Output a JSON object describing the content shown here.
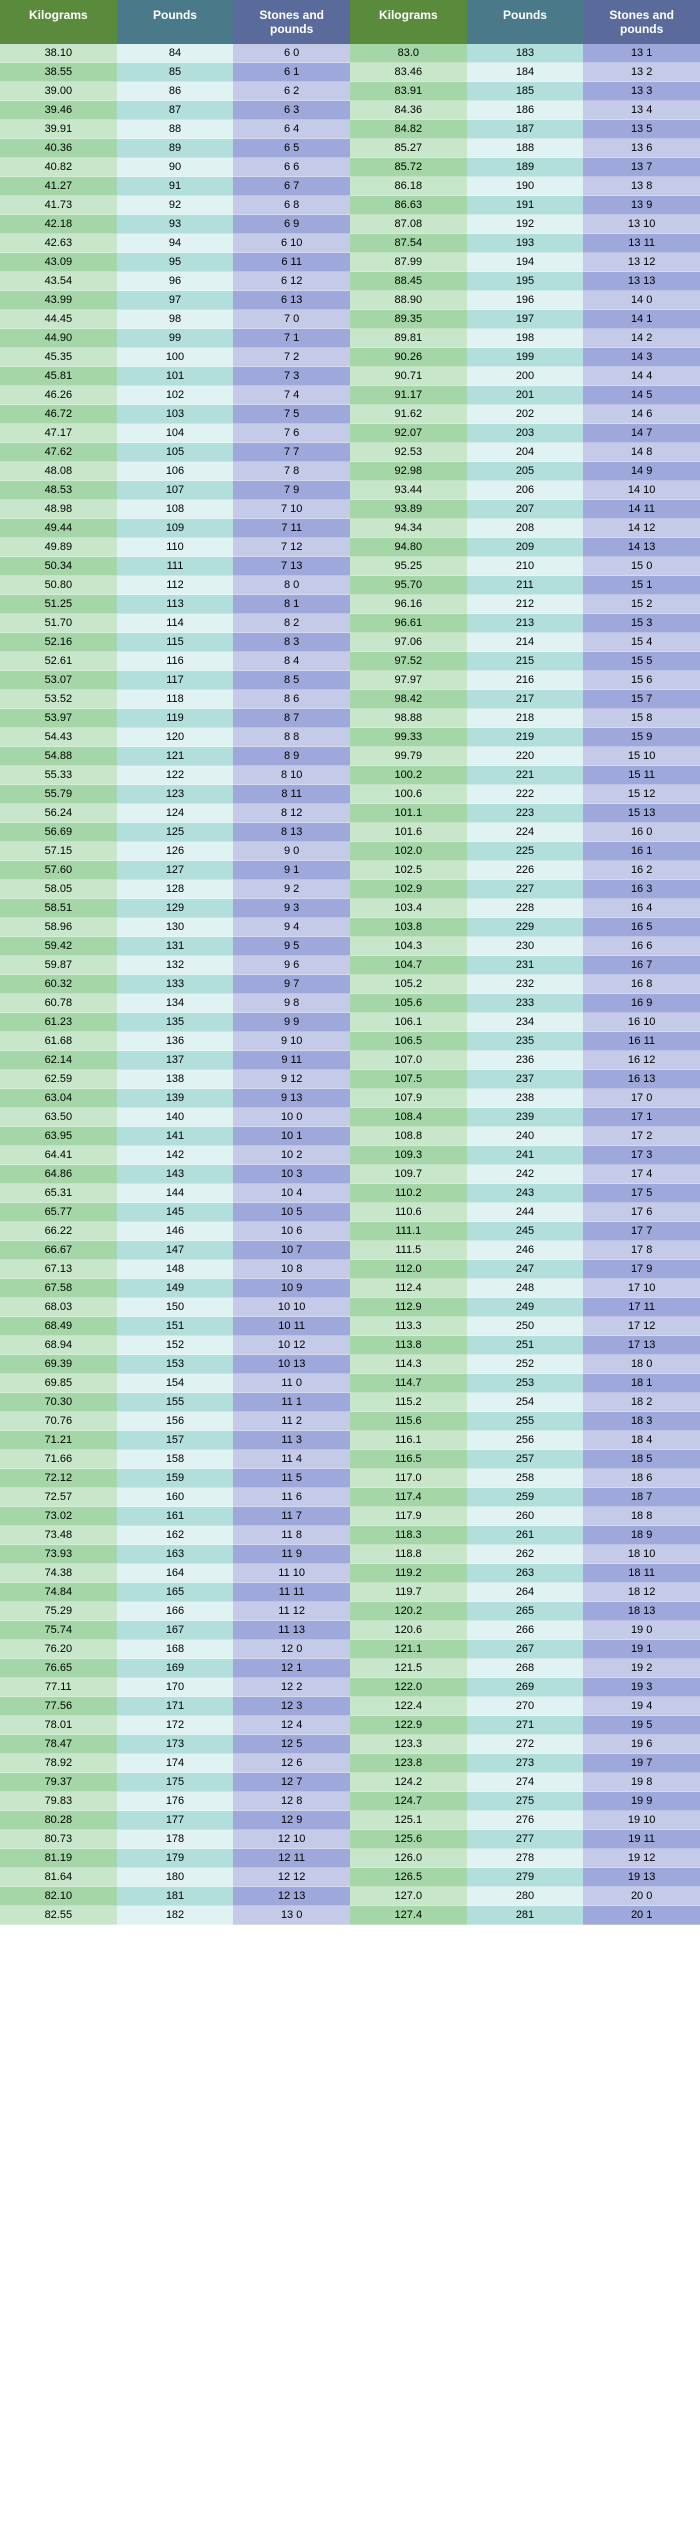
{
  "headers": {
    "kilograms": "Kilograms",
    "pounds": "Pounds",
    "stones_and_pounds": "Stones and pounds"
  },
  "rows": [
    {
      "kg": "38.10",
      "lb": 84,
      "st": 6,
      "sp": 0
    },
    {
      "kg": "38.55",
      "lb": 85,
      "st": 6,
      "sp": 1
    },
    {
      "kg": "39.00",
      "lb": 86,
      "st": 6,
      "sp": 2
    },
    {
      "kg": "39.46",
      "lb": 87,
      "st": 6,
      "sp": 3
    },
    {
      "kg": "39.91",
      "lb": 88,
      "st": 6,
      "sp": 4
    },
    {
      "kg": "40.36",
      "lb": 89,
      "st": 6,
      "sp": 5
    },
    {
      "kg": "40.82",
      "lb": 90,
      "st": 6,
      "sp": 6
    },
    {
      "kg": "41.27",
      "lb": 91,
      "st": 6,
      "sp": 7
    },
    {
      "kg": "41.73",
      "lb": 92,
      "st": 6,
      "sp": 8
    },
    {
      "kg": "42.18",
      "lb": 93,
      "st": 6,
      "sp": 9
    },
    {
      "kg": "42.63",
      "lb": 94,
      "st": 6,
      "sp": 10
    },
    {
      "kg": "43.09",
      "lb": 95,
      "st": 6,
      "sp": 11
    },
    {
      "kg": "43.54",
      "lb": 96,
      "st": 6,
      "sp": 12
    },
    {
      "kg": "43.99",
      "lb": 97,
      "st": 6,
      "sp": 13
    },
    {
      "kg": "44.45",
      "lb": 98,
      "st": 7,
      "sp": 0
    },
    {
      "kg": "44.90",
      "lb": 99,
      "st": 7,
      "sp": 1
    },
    {
      "kg": "45.35",
      "lb": 100,
      "st": 7,
      "sp": 2
    },
    {
      "kg": "45.81",
      "lb": 101,
      "st": 7,
      "sp": 3
    },
    {
      "kg": "46.26",
      "lb": 102,
      "st": 7,
      "sp": 4
    },
    {
      "kg": "46.72",
      "lb": 103,
      "st": 7,
      "sp": 5
    },
    {
      "kg": "47.17",
      "lb": 104,
      "st": 7,
      "sp": 6
    },
    {
      "kg": "47.62",
      "lb": 105,
      "st": 7,
      "sp": 7
    },
    {
      "kg": "48.08",
      "lb": 106,
      "st": 7,
      "sp": 8
    },
    {
      "kg": "48.53",
      "lb": 107,
      "st": 7,
      "sp": 9
    },
    {
      "kg": "48.98",
      "lb": 108,
      "st": 7,
      "sp": 10
    },
    {
      "kg": "49.44",
      "lb": 109,
      "st": 7,
      "sp": 11
    },
    {
      "kg": "49.89",
      "lb": 110,
      "st": 7,
      "sp": 12
    },
    {
      "kg": "50.34",
      "lb": 111,
      "st": 7,
      "sp": 13
    },
    {
      "kg": "50.80",
      "lb": 112,
      "st": 8,
      "sp": 0
    },
    {
      "kg": "51.25",
      "lb": 113,
      "st": 8,
      "sp": 1
    },
    {
      "kg": "51.70",
      "lb": 114,
      "st": 8,
      "sp": 2
    },
    {
      "kg": "52.16",
      "lb": 115,
      "st": 8,
      "sp": 3
    },
    {
      "kg": "52.61",
      "lb": 116,
      "st": 8,
      "sp": 4
    },
    {
      "kg": "53.07",
      "lb": 117,
      "st": 8,
      "sp": 5
    },
    {
      "kg": "53.52",
      "lb": 118,
      "st": 8,
      "sp": 6
    },
    {
      "kg": "53.97",
      "lb": 119,
      "st": 8,
      "sp": 7
    },
    {
      "kg": "54.43",
      "lb": 120,
      "st": 8,
      "sp": 8
    },
    {
      "kg": "54.88",
      "lb": 121,
      "st": 8,
      "sp": 9
    },
    {
      "kg": "55.33",
      "lb": 122,
      "st": 8,
      "sp": 10
    },
    {
      "kg": "55.79",
      "lb": 123,
      "st": 8,
      "sp": 11
    },
    {
      "kg": "56.24",
      "lb": 124,
      "st": 8,
      "sp": 12
    },
    {
      "kg": "56.69",
      "lb": 125,
      "st": 8,
      "sp": 13
    },
    {
      "kg": "57.15",
      "lb": 126,
      "st": 9,
      "sp": 0
    },
    {
      "kg": "57.60",
      "lb": 127,
      "st": 9,
      "sp": 1
    },
    {
      "kg": "58.05",
      "lb": 128,
      "st": 9,
      "sp": 2
    },
    {
      "kg": "58.51",
      "lb": 129,
      "st": 9,
      "sp": 3
    },
    {
      "kg": "58.96",
      "lb": 130,
      "st": 9,
      "sp": 4
    },
    {
      "kg": "59.42",
      "lb": 131,
      "st": 9,
      "sp": 5
    },
    {
      "kg": "59.87",
      "lb": 132,
      "st": 9,
      "sp": 6
    },
    {
      "kg": "60.32",
      "lb": 133,
      "st": 9,
      "sp": 7
    },
    {
      "kg": "60.78",
      "lb": 134,
      "st": 9,
      "sp": 8
    },
    {
      "kg": "61.23",
      "lb": 135,
      "st": 9,
      "sp": 9
    },
    {
      "kg": "61.68",
      "lb": 136,
      "st": 9,
      "sp": 10
    },
    {
      "kg": "62.14",
      "lb": 137,
      "st": 9,
      "sp": 11
    },
    {
      "kg": "62.59",
      "lb": 138,
      "st": 9,
      "sp": 12
    },
    {
      "kg": "63.04",
      "lb": 139,
      "st": 9,
      "sp": 13
    },
    {
      "kg": "63.50",
      "lb": 140,
      "st": 10,
      "sp": 0
    },
    {
      "kg": "63.95",
      "lb": 141,
      "st": 10,
      "sp": 1
    },
    {
      "kg": "64.41",
      "lb": 142,
      "st": 10,
      "sp": 2
    },
    {
      "kg": "64.86",
      "lb": 143,
      "st": 10,
      "sp": 3
    },
    {
      "kg": "65.31",
      "lb": 144,
      "st": 10,
      "sp": 4
    },
    {
      "kg": "65.77",
      "lb": 145,
      "st": 10,
      "sp": 5
    },
    {
      "kg": "66.22",
      "lb": 146,
      "st": 10,
      "sp": 6
    },
    {
      "kg": "66.67",
      "lb": 147,
      "st": 10,
      "sp": 7
    },
    {
      "kg": "67.13",
      "lb": 148,
      "st": 10,
      "sp": 8
    },
    {
      "kg": "67.58",
      "lb": 149,
      "st": 10,
      "sp": 9
    },
    {
      "kg": "68.03",
      "lb": 150,
      "st": 10,
      "sp": 10
    },
    {
      "kg": "68.49",
      "lb": 151,
      "st": 10,
      "sp": 11
    },
    {
      "kg": "68.94",
      "lb": 152,
      "st": 10,
      "sp": 12
    },
    {
      "kg": "69.39",
      "lb": 153,
      "st": 10,
      "sp": 13
    },
    {
      "kg": "69.85",
      "lb": 154,
      "st": 11,
      "sp": 0
    },
    {
      "kg": "70.30",
      "lb": 155,
      "st": 11,
      "sp": 1
    },
    {
      "kg": "70.76",
      "lb": 156,
      "st": 11,
      "sp": 2
    },
    {
      "kg": "71.21",
      "lb": 157,
      "st": 11,
      "sp": 3
    },
    {
      "kg": "71.66",
      "lb": 158,
      "st": 11,
      "sp": 4
    },
    {
      "kg": "72.12",
      "lb": 159,
      "st": 11,
      "sp": 5
    },
    {
      "kg": "72.57",
      "lb": 160,
      "st": 11,
      "sp": 6
    },
    {
      "kg": "73.02",
      "lb": 161,
      "st": 11,
      "sp": 7
    },
    {
      "kg": "73.48",
      "lb": 162,
      "st": 11,
      "sp": 8
    },
    {
      "kg": "73.93",
      "lb": 163,
      "st": 11,
      "sp": 9
    },
    {
      "kg": "74.38",
      "lb": 164,
      "st": 11,
      "sp": 10
    },
    {
      "kg": "74.84",
      "lb": 165,
      "st": 11,
      "sp": 11
    },
    {
      "kg": "75.29",
      "lb": 166,
      "st": 11,
      "sp": 12
    },
    {
      "kg": "75.74",
      "lb": 167,
      "st": 11,
      "sp": 13
    },
    {
      "kg": "76.20",
      "lb": 168,
      "st": 12,
      "sp": 0
    },
    {
      "kg": "76.65",
      "lb": 169,
      "st": 12,
      "sp": 1
    },
    {
      "kg": "77.11",
      "lb": 170,
      "st": 12,
      "sp": 2
    },
    {
      "kg": "77.56",
      "lb": 171,
      "st": 12,
      "sp": 3
    },
    {
      "kg": "78.01",
      "lb": 172,
      "st": 12,
      "sp": 4
    },
    {
      "kg": "78.47",
      "lb": 173,
      "st": 12,
      "sp": 5
    },
    {
      "kg": "78.92",
      "lb": 174,
      "st": 12,
      "sp": 6
    },
    {
      "kg": "79.37",
      "lb": 175,
      "st": 12,
      "sp": 7
    },
    {
      "kg": "79.83",
      "lb": 176,
      "st": 12,
      "sp": 8
    },
    {
      "kg": "80.28",
      "lb": 177,
      "st": 12,
      "sp": 9
    },
    {
      "kg": "80.73",
      "lb": 178,
      "st": 12,
      "sp": 10
    },
    {
      "kg": "81.19",
      "lb": 179,
      "st": 12,
      "sp": 11
    },
    {
      "kg": "81.64",
      "lb": 180,
      "st": 12,
      "sp": 12
    },
    {
      "kg": "82.10",
      "lb": 181,
      "st": 12,
      "sp": 13
    },
    {
      "kg": "82.55",
      "lb": 182,
      "st": 13,
      "sp": 0
    },
    {
      "kg": "83.0",
      "lb": 183,
      "st": 13,
      "sp": 1
    },
    {
      "kg": "83.46",
      "lb": 184,
      "st": 13,
      "sp": 2
    },
    {
      "kg": "83.91",
      "lb": 185,
      "st": 13,
      "sp": 3
    },
    {
      "kg": "84.36",
      "lb": 186,
      "st": 13,
      "sp": 4
    },
    {
      "kg": "84.82",
      "lb": 187,
      "st": 13,
      "sp": 5
    },
    {
      "kg": "85.27",
      "lb": 188,
      "st": 13,
      "sp": 6
    },
    {
      "kg": "85.72",
      "lb": 189,
      "st": 13,
      "sp": 7
    },
    {
      "kg": "86.18",
      "lb": 190,
      "st": 13,
      "sp": 8
    },
    {
      "kg": "86.63",
      "lb": 191,
      "st": 13,
      "sp": 9
    },
    {
      "kg": "87.08",
      "lb": 192,
      "st": 13,
      "sp": 10
    },
    {
      "kg": "87.54",
      "lb": 193,
      "st": 13,
      "sp": 11
    },
    {
      "kg": "87.99",
      "lb": 194,
      "st": 13,
      "sp": 12
    },
    {
      "kg": "88.45",
      "lb": 195,
      "st": 13,
      "sp": 13
    },
    {
      "kg": "88.90",
      "lb": 196,
      "st": 14,
      "sp": 0
    },
    {
      "kg": "89.35",
      "lb": 197,
      "st": 14,
      "sp": 1
    },
    {
      "kg": "89.81",
      "lb": 198,
      "st": 14,
      "sp": 2
    },
    {
      "kg": "90.26",
      "lb": 199,
      "st": 14,
      "sp": 3
    },
    {
      "kg": "90.71",
      "lb": 200,
      "st": 14,
      "sp": 4
    },
    {
      "kg": "91.17",
      "lb": 201,
      "st": 14,
      "sp": 5
    },
    {
      "kg": "91.62",
      "lb": 202,
      "st": 14,
      "sp": 6
    },
    {
      "kg": "92.07",
      "lb": 203,
      "st": 14,
      "sp": 7
    },
    {
      "kg": "92.53",
      "lb": 204,
      "st": 14,
      "sp": 8
    },
    {
      "kg": "92.98",
      "lb": 205,
      "st": 14,
      "sp": 9
    },
    {
      "kg": "93.44",
      "lb": 206,
      "st": 14,
      "sp": 10
    },
    {
      "kg": "93.89",
      "lb": 207,
      "st": 14,
      "sp": 11
    },
    {
      "kg": "94.34",
      "lb": 208,
      "st": 14,
      "sp": 12
    },
    {
      "kg": "94.80",
      "lb": 209,
      "st": 14,
      "sp": 13
    },
    {
      "kg": "95.25",
      "lb": 210,
      "st": 15,
      "sp": 0
    },
    {
      "kg": "95.70",
      "lb": 211,
      "st": 15,
      "sp": 1
    },
    {
      "kg": "96.16",
      "lb": 212,
      "st": 15,
      "sp": 2
    },
    {
      "kg": "96.61",
      "lb": 213,
      "st": 15,
      "sp": 3
    },
    {
      "kg": "97.06",
      "lb": 214,
      "st": 15,
      "sp": 4
    },
    {
      "kg": "97.52",
      "lb": 215,
      "st": 15,
      "sp": 5
    },
    {
      "kg": "97.97",
      "lb": 216,
      "st": 15,
      "sp": 6
    },
    {
      "kg": "98.42",
      "lb": 217,
      "st": 15,
      "sp": 7
    },
    {
      "kg": "98.88",
      "lb": 218,
      "st": 15,
      "sp": 8
    },
    {
      "kg": "99.33",
      "lb": 219,
      "st": 15,
      "sp": 9
    },
    {
      "kg": "99.79",
      "lb": 220,
      "st": 15,
      "sp": 10
    },
    {
      "kg": "100.2",
      "lb": 221,
      "st": 15,
      "sp": 11
    },
    {
      "kg": "100.6",
      "lb": 222,
      "st": 15,
      "sp": 12
    },
    {
      "kg": "101.1",
      "lb": 223,
      "st": 15,
      "sp": 13
    },
    {
      "kg": "101.6",
      "lb": 224,
      "st": 16,
      "sp": 0
    },
    {
      "kg": "102.0",
      "lb": 225,
      "st": 16,
      "sp": 1
    },
    {
      "kg": "102.5",
      "lb": 226,
      "st": 16,
      "sp": 2
    },
    {
      "kg": "102.9",
      "lb": 227,
      "st": 16,
      "sp": 3
    },
    {
      "kg": "103.4",
      "lb": 228,
      "st": 16,
      "sp": 4
    },
    {
      "kg": "103.8",
      "lb": 229,
      "st": 16,
      "sp": 5
    },
    {
      "kg": "104.3",
      "lb": 230,
      "st": 16,
      "sp": 6
    },
    {
      "kg": "104.7",
      "lb": 231,
      "st": 16,
      "sp": 7
    },
    {
      "kg": "105.2",
      "lb": 232,
      "st": 16,
      "sp": 8
    },
    {
      "kg": "105.6",
      "lb": 233,
      "st": 16,
      "sp": 9
    },
    {
      "kg": "106.1",
      "lb": 234,
      "st": 16,
      "sp": 10
    },
    {
      "kg": "106.5",
      "lb": 235,
      "st": 16,
      "sp": 11
    },
    {
      "kg": "107.0",
      "lb": 236,
      "st": 16,
      "sp": 12
    },
    {
      "kg": "107.5",
      "lb": 237,
      "st": 16,
      "sp": 13
    },
    {
      "kg": "107.9",
      "lb": 238,
      "st": 17,
      "sp": 0
    },
    {
      "kg": "108.4",
      "lb": 239,
      "st": 17,
      "sp": 1
    },
    {
      "kg": "108.8",
      "lb": 240,
      "st": 17,
      "sp": 2
    },
    {
      "kg": "109.3",
      "lb": 241,
      "st": 17,
      "sp": 3
    },
    {
      "kg": "109.7",
      "lb": 242,
      "st": 17,
      "sp": 4
    },
    {
      "kg": "110.2",
      "lb": 243,
      "st": 17,
      "sp": 5
    },
    {
      "kg": "110.6",
      "lb": 244,
      "st": 17,
      "sp": 6
    },
    {
      "kg": "111.1",
      "lb": 245,
      "st": 17,
      "sp": 7
    },
    {
      "kg": "111.5",
      "lb": 246,
      "st": 17,
      "sp": 8
    },
    {
      "kg": "112.0",
      "lb": 247,
      "st": 17,
      "sp": 9
    },
    {
      "kg": "112.4",
      "lb": 248,
      "st": 17,
      "sp": 10
    },
    {
      "kg": "112.9",
      "lb": 249,
      "st": 17,
      "sp": 11
    },
    {
      "kg": "113.3",
      "lb": 250,
      "st": 17,
      "sp": 12
    },
    {
      "kg": "113.8",
      "lb": 251,
      "st": 17,
      "sp": 13
    },
    {
      "kg": "114.3",
      "lb": 252,
      "st": 18,
      "sp": 0
    },
    {
      "kg": "114.7",
      "lb": 253,
      "st": 18,
      "sp": 1
    },
    {
      "kg": "115.2",
      "lb": 254,
      "st": 18,
      "sp": 2
    },
    {
      "kg": "115.6",
      "lb": 255,
      "st": 18,
      "sp": 3
    },
    {
      "kg": "116.1",
      "lb": 256,
      "st": 18,
      "sp": 4
    },
    {
      "kg": "116.5",
      "lb": 257,
      "st": 18,
      "sp": 5
    },
    {
      "kg": "117.0",
      "lb": 258,
      "st": 18,
      "sp": 6
    },
    {
      "kg": "117.4",
      "lb": 259,
      "st": 18,
      "sp": 7
    },
    {
      "kg": "117.9",
      "lb": 260,
      "st": 18,
      "sp": 8
    },
    {
      "kg": "118.3",
      "lb": 261,
      "st": 18,
      "sp": 9
    },
    {
      "kg": "118.8",
      "lb": 262,
      "st": 18,
      "sp": 10
    },
    {
      "kg": "119.2",
      "lb": 263,
      "st": 18,
      "sp": 11
    },
    {
      "kg": "119.7",
      "lb": 264,
      "st": 18,
      "sp": 12
    },
    {
      "kg": "120.2",
      "lb": 265,
      "st": 18,
      "sp": 13
    },
    {
      "kg": "120.6",
      "lb": 266,
      "st": 19,
      "sp": 0
    },
    {
      "kg": "121.1",
      "lb": 267,
      "st": 19,
      "sp": 1
    },
    {
      "kg": "121.5",
      "lb": 268,
      "st": 19,
      "sp": 2
    },
    {
      "kg": "122.0",
      "lb": 269,
      "st": 19,
      "sp": 3
    },
    {
      "kg": "122.4",
      "lb": 270,
      "st": 19,
      "sp": 4
    },
    {
      "kg": "122.9",
      "lb": 271,
      "st": 19,
      "sp": 5
    },
    {
      "kg": "123.3",
      "lb": 272,
      "st": 19,
      "sp": 6
    },
    {
      "kg": "123.8",
      "lb": 273,
      "st": 19,
      "sp": 7
    },
    {
      "kg": "124.2",
      "lb": 274,
      "st": 19,
      "sp": 8
    },
    {
      "kg": "124.7",
      "lb": 275,
      "st": 19,
      "sp": 9
    },
    {
      "kg": "125.1",
      "lb": 276,
      "st": 19,
      "sp": 10
    },
    {
      "kg": "125.6",
      "lb": 277,
      "st": 19,
      "sp": 11
    },
    {
      "kg": "126.0",
      "lb": 278,
      "st": 19,
      "sp": 12
    },
    {
      "kg": "126.5",
      "lb": 279,
      "st": 19,
      "sp": 13
    },
    {
      "kg": "127.0",
      "lb": 280,
      "st": 20,
      "sp": 0
    },
    {
      "kg": "127.4",
      "lb": 281,
      "st": 20,
      "sp": 1
    }
  ]
}
